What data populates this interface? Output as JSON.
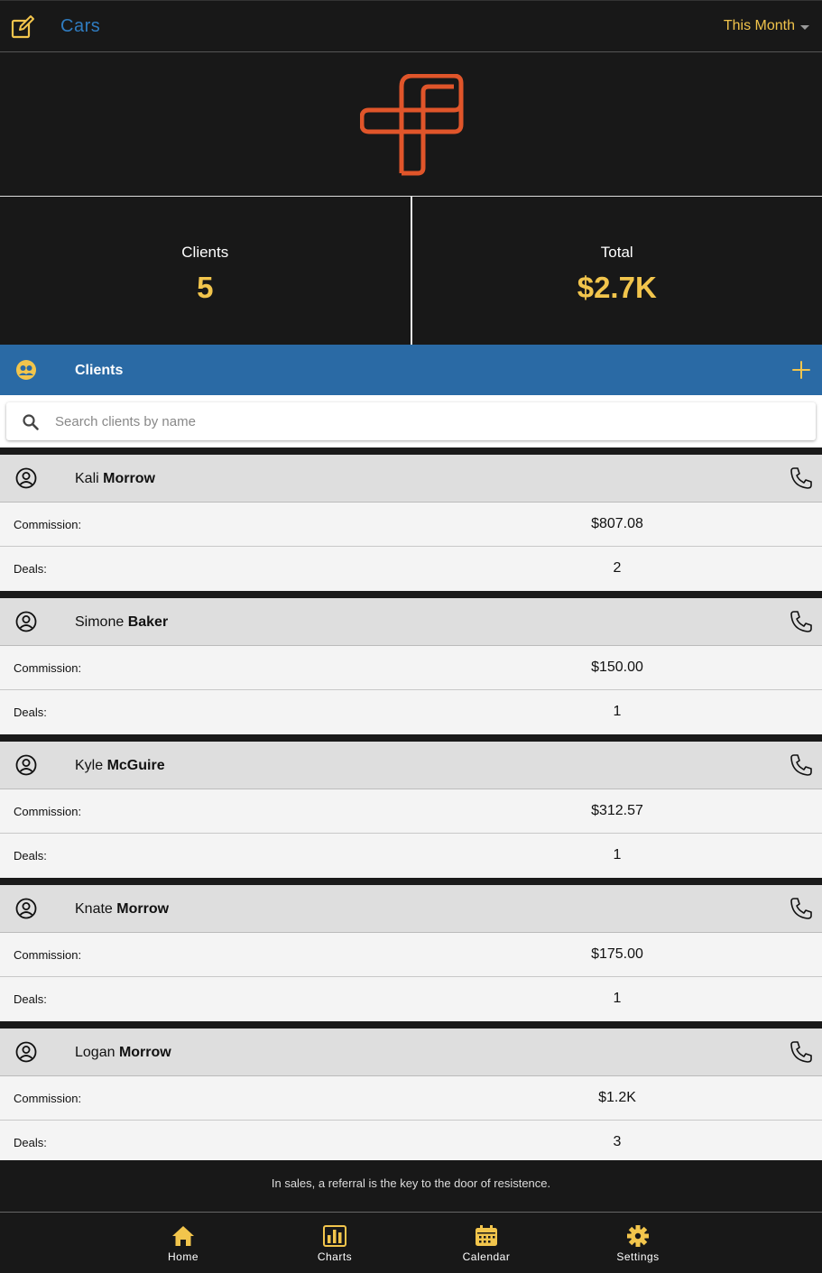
{
  "topbar": {
    "title": "Cars",
    "period": "This Month",
    "edit_icon": "edit-note-icon"
  },
  "stats": {
    "clients_label": "Clients",
    "clients_value": "5",
    "total_label": "Total",
    "total_value": "$2.7K"
  },
  "clients_section": {
    "label": "Clients",
    "icon": "group-icon",
    "add_icon": "plus-icon"
  },
  "search": {
    "placeholder": "Search clients by name"
  },
  "labels": {
    "commission": "Commission:",
    "deals": "Deals:"
  },
  "clients": [
    {
      "first": "Kali",
      "last": "Morrow",
      "commission": "$807.08",
      "deals": "2"
    },
    {
      "first": "Simone",
      "last": "Baker",
      "commission": "$150.00",
      "deals": "1"
    },
    {
      "first": "Kyle",
      "last": "McGuire",
      "commission": "$312.57",
      "deals": "1"
    },
    {
      "first": "Knate",
      "last": "Morrow",
      "commission": "$175.00",
      "deals": "1"
    },
    {
      "first": "Logan",
      "last": "Morrow",
      "commission": "$1.2K",
      "deals": "3"
    }
  ],
  "quote": "In sales, a referral is the key to the door of resistence.",
  "tabs": [
    {
      "label": "Home",
      "icon": "home-icon"
    },
    {
      "label": "Charts",
      "icon": "bar-chart-icon"
    },
    {
      "label": "Calendar",
      "icon": "calendar-icon"
    },
    {
      "label": "Settings",
      "icon": "gear-icon"
    }
  ],
  "colors": {
    "accent_yellow": "#f2c54c",
    "accent_blue": "#2a6aa5",
    "logo_orange": "#e0552a",
    "background": "#181818"
  }
}
